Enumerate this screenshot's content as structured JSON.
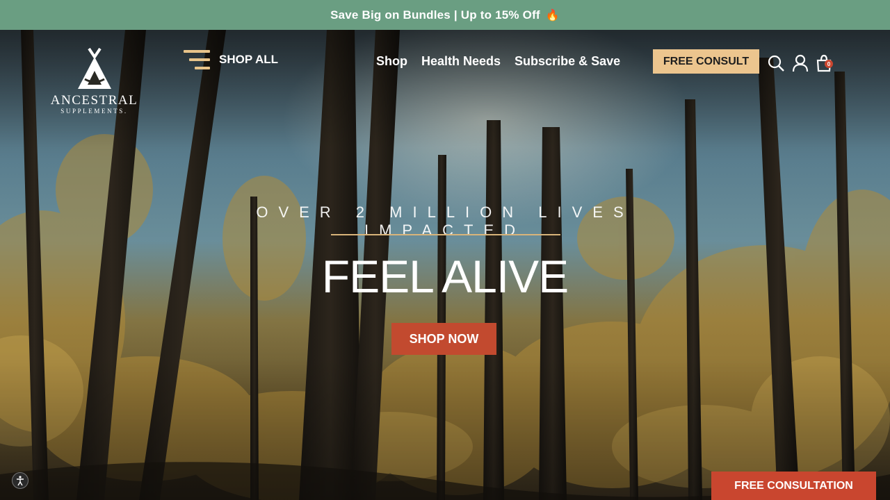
{
  "announcement": {
    "text": "Save Big on Bundles | Up to 15% Off",
    "emoji": "🔥"
  },
  "logo": {
    "brand": "ANCESTRAL",
    "sub": "SUPPLEMENTS."
  },
  "header": {
    "shop_all_label": "SHOP ALL",
    "nav": [
      "Shop",
      "Health Needs",
      "Subscribe & Save"
    ],
    "consult_label": "FREE CONSULT",
    "cart_count": "0"
  },
  "hero": {
    "tagline": "OVER 2 MILLION LIVES IMPACTED",
    "headline": "FEEL ALIVE",
    "cta_label": "SHOP NOW"
  },
  "floating": {
    "consultation_label": "FREE CONSULTATION"
  },
  "colors": {
    "announcement_bg": "#6a9e82",
    "consult_bg": "#ecc58e",
    "cta_bg": "#c24a2f",
    "divider": "#d9b47a"
  },
  "icons": [
    "menu-icon",
    "search-icon",
    "account-icon",
    "cart-icon",
    "accessibility-icon"
  ]
}
